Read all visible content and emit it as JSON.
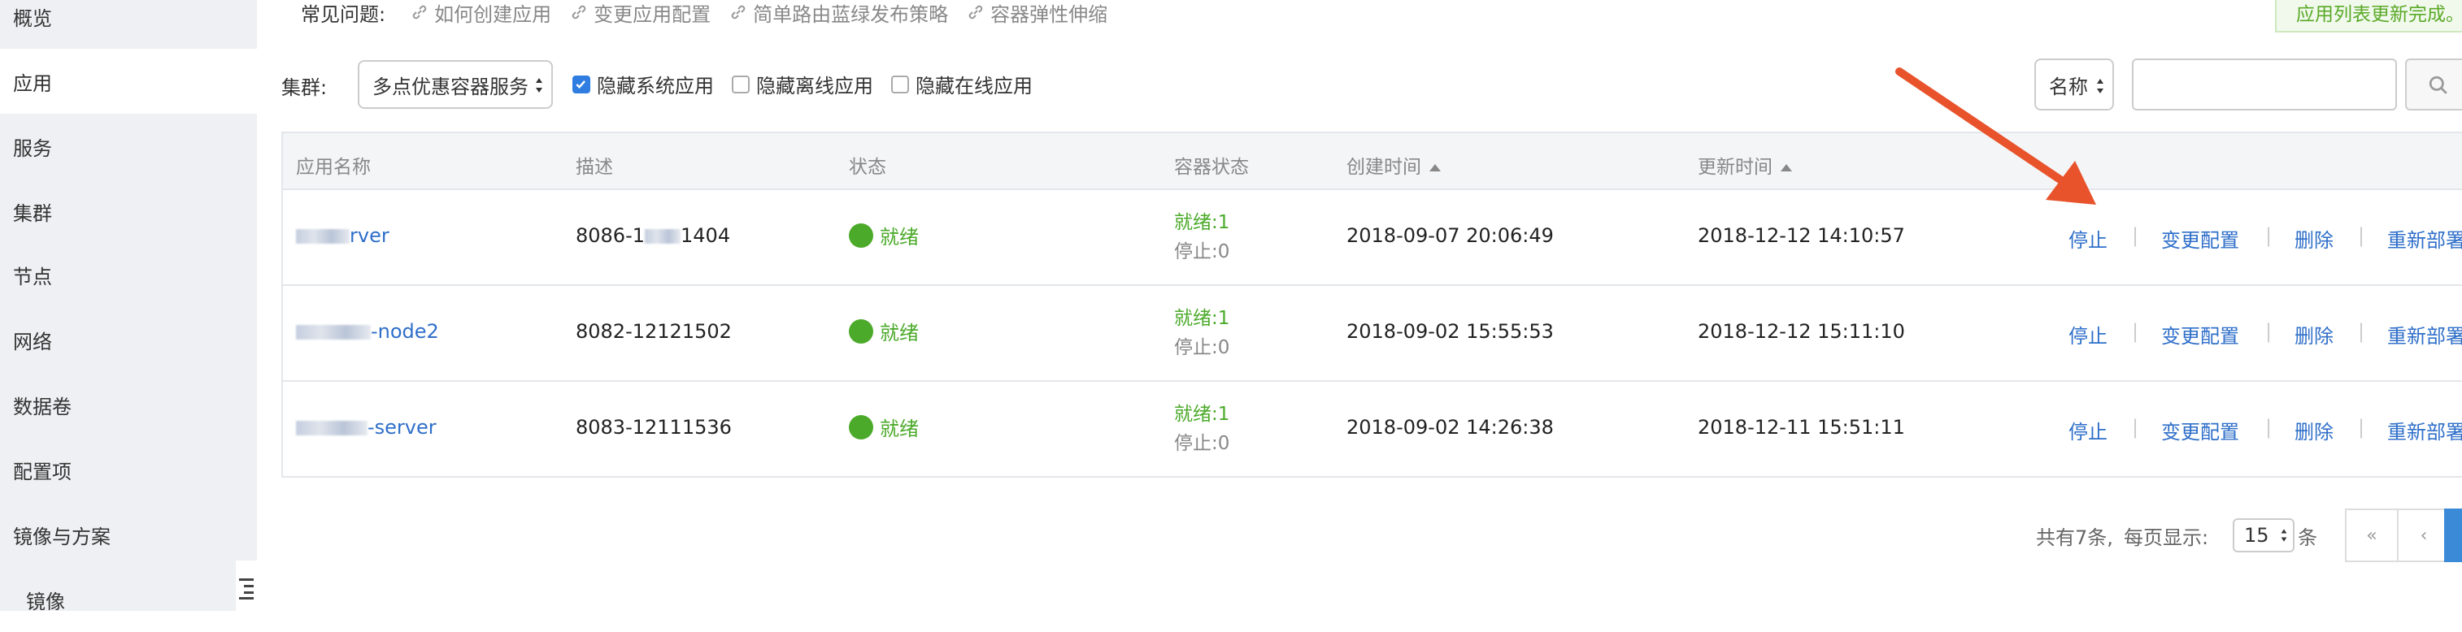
{
  "sidebar": {
    "items": [
      {
        "label": "概览"
      },
      {
        "label": "应用"
      },
      {
        "label": "服务"
      },
      {
        "label": "集群"
      },
      {
        "label": "节点"
      },
      {
        "label": "网络"
      },
      {
        "label": "数据卷"
      },
      {
        "label": "配置项"
      },
      {
        "label": "镜像与方案"
      },
      {
        "label": "镜像"
      }
    ]
  },
  "faq": {
    "label": "常见问题:",
    "links": [
      "如何创建应用",
      "变更应用配置",
      "简单路由蓝绿发布策略",
      "容器弹性伸缩"
    ]
  },
  "notice": "应用列表更新完成。",
  "filters": {
    "cluster_label": "集群:",
    "cluster_value": "多点优惠容器服务",
    "checkboxes": [
      {
        "label": "隐藏系统应用",
        "checked": true
      },
      {
        "label": "隐藏离线应用",
        "checked": false
      },
      {
        "label": "隐藏在线应用",
        "checked": false
      }
    ],
    "search_field": "名称",
    "search_placeholder": ""
  },
  "table": {
    "headers": [
      "应用名称",
      "描述",
      "状态",
      "容器状态",
      "创建时间",
      "更新时间"
    ],
    "rows": [
      {
        "name": "rver",
        "desc_prefix": "8086-1",
        "desc_suffix": "1404",
        "status": "就绪",
        "ready": "就绪:1",
        "stopped": "停止:0",
        "created": "2018-09-07 20:06:49",
        "updated": "2018-12-12 14:10:57"
      },
      {
        "name": "-node2",
        "desc": "8082-12121502",
        "status": "就绪",
        "ready": "就绪:1",
        "stopped": "停止:0",
        "created": "2018-09-02 15:55:53",
        "updated": "2018-12-12 15:11:10"
      },
      {
        "name": "-server",
        "desc": "8083-12111536",
        "status": "就绪",
        "ready": "就绪:1",
        "stopped": "停止:0",
        "created": "2018-09-02 14:26:38",
        "updated": "2018-12-11 15:51:11"
      }
    ],
    "actions": [
      "停止",
      "变更配置",
      "删除",
      "重新部署"
    ]
  },
  "pagination": {
    "total": "共有7条,",
    "per_page_label": "每页显示:",
    "per_page": "15",
    "unit": "条",
    "first": "«",
    "prev": "‹"
  },
  "colors": {
    "link": "#2f6fc9",
    "ready": "#4caa2a",
    "arrow": "#e8532c",
    "checkbox": "#2f7de1"
  }
}
